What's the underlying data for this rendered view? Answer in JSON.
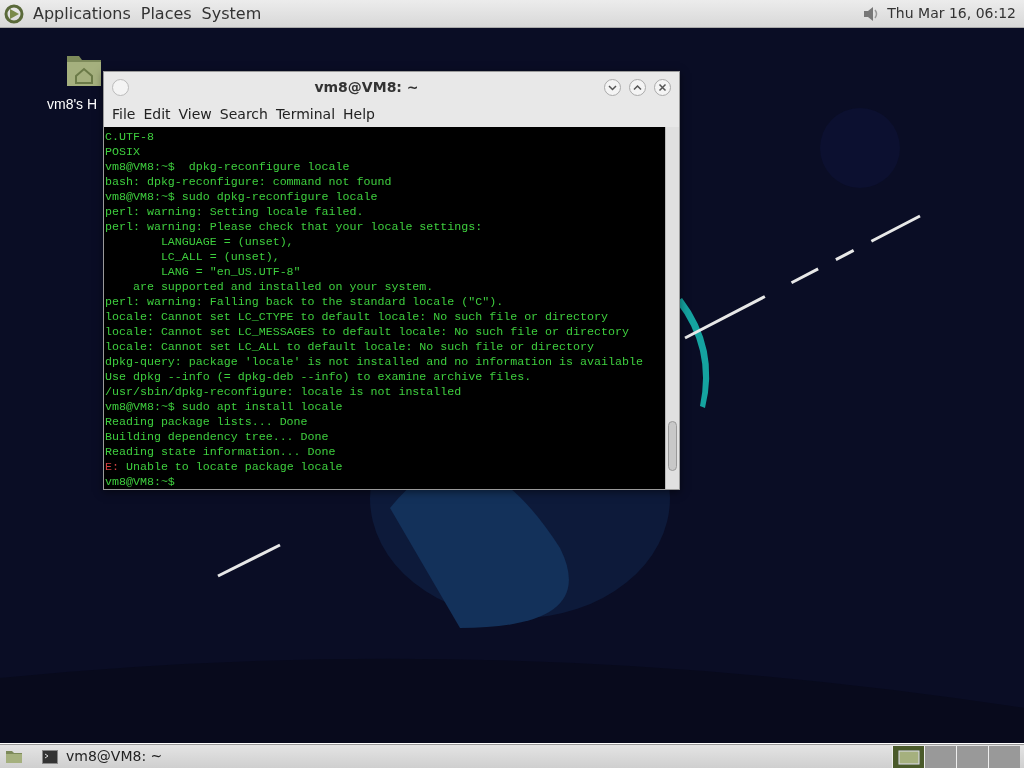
{
  "top_panel": {
    "menus": [
      {
        "label": "Applications"
      },
      {
        "label": "Places"
      },
      {
        "label": "System"
      }
    ],
    "clock": "Thu Mar 16, 06:12"
  },
  "desktop_icons": [
    {
      "label": "vm8's H"
    }
  ],
  "window": {
    "title": "vm8@VM8: ~",
    "menu": [
      {
        "label": "File"
      },
      {
        "label": "Edit"
      },
      {
        "label": "View"
      },
      {
        "label": "Search"
      },
      {
        "label": "Terminal"
      },
      {
        "label": "Help"
      }
    ],
    "lines": [
      {
        "kind": "output",
        "text": "C.UTF-8"
      },
      {
        "kind": "output",
        "text": "POSIX"
      },
      {
        "kind": "output",
        "text": "vm8@VM8:~$  dpkg-reconfigure locale"
      },
      {
        "kind": "output",
        "text": "bash: dpkg-reconfigure: command not found"
      },
      {
        "kind": "output",
        "text": "vm8@VM8:~$ sudo dpkg-reconfigure locale"
      },
      {
        "kind": "output",
        "text": "perl: warning: Setting locale failed."
      },
      {
        "kind": "output",
        "text": "perl: warning: Please check that your locale settings:"
      },
      {
        "kind": "output",
        "text": "        LANGUAGE = (unset),"
      },
      {
        "kind": "output",
        "text": "        LC_ALL = (unset),"
      },
      {
        "kind": "output",
        "text": "        LANG = \"en_US.UTF-8\""
      },
      {
        "kind": "output",
        "text": "    are supported and installed on your system."
      },
      {
        "kind": "output",
        "text": "perl: warning: Falling back to the standard locale (\"C\")."
      },
      {
        "kind": "output",
        "text": "locale: Cannot set LC_CTYPE to default locale: No such file or directory"
      },
      {
        "kind": "output",
        "text": "locale: Cannot set LC_MESSAGES to default locale: No such file or directory"
      },
      {
        "kind": "output",
        "text": "locale: Cannot set LC_ALL to default locale: No such file or directory"
      },
      {
        "kind": "output",
        "text": "dpkg-query: package 'locale' is not installed and no information is available"
      },
      {
        "kind": "output",
        "text": "Use dpkg --info (= dpkg-deb --info) to examine archive files."
      },
      {
        "kind": "output",
        "text": "/usr/sbin/dpkg-reconfigure: locale is not installed"
      },
      {
        "kind": "output",
        "text": "vm8@VM8:~$ sudo apt install locale"
      },
      {
        "kind": "output",
        "text": "Reading package lists... Done"
      },
      {
        "kind": "output",
        "text": "Building dependency tree... Done"
      },
      {
        "kind": "output",
        "text": "Reading state information... Done"
      },
      {
        "kind": "error",
        "prefix": "E:",
        "text": " Unable to locate package locale"
      },
      {
        "kind": "output",
        "text": "vm8@VM8:~$"
      }
    ]
  },
  "taskbar": {
    "tasks": [
      {
        "label": "vm8@VM8: ~",
        "selected": false
      }
    ],
    "workspaces": [
      {
        "selected": true
      },
      {
        "selected": false
      },
      {
        "selected": false
      },
      {
        "selected": false
      }
    ]
  }
}
